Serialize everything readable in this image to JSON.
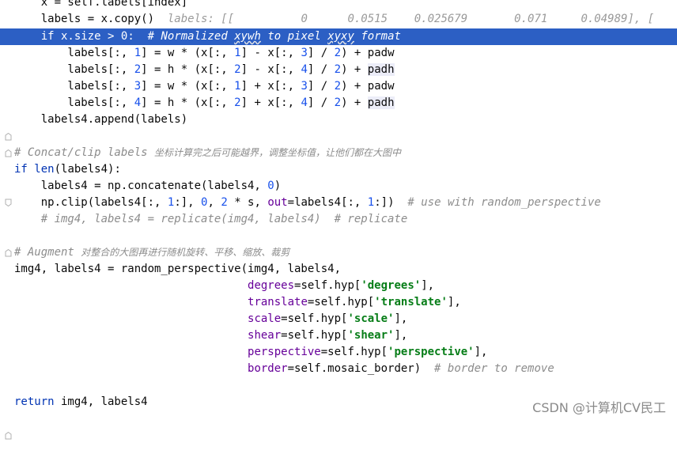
{
  "lines": [
    {
      "text": "    x = self.labels[index]"
    },
    {
      "prefix": "    labels = x.copy()",
      "hint": "  labels: [[          0      0.0515    0.025679       0.071     0.04989], ["
    },
    {
      "if_kw": "if",
      "mid1": " x.size > ",
      "num": "0",
      "mid2": ":  ",
      "cm_a": "# Normalized ",
      "cm_b": "xywh",
      "cm_c": " to pixel ",
      "cm_d": "xyxy",
      "cm_e": " format"
    },
    {
      "a": "        labels[:, ",
      "n1": "1",
      "b": "] = w * (x[:, ",
      "n2": "1",
      "c": "] - x[:, ",
      "n3": "3",
      "d": "] / ",
      "n4": "2",
      "e": ") + ",
      "pad": "padw"
    },
    {
      "a": "        labels[:, ",
      "n1": "2",
      "b": "] = h * (x[:, ",
      "n2": "2",
      "c": "] - x[:, ",
      "n3": "4",
      "d": "] / ",
      "n4": "2",
      "e": ") + ",
      "pad": "padh"
    },
    {
      "a": "        labels[:, ",
      "n1": "3",
      "b": "] = w * (x[:, ",
      "n2": "1",
      "c": "] + x[:, ",
      "n3": "3",
      "d": "] / ",
      "n4": "2",
      "e": ") + ",
      "pad": "padw"
    },
    {
      "a": "        labels[:, ",
      "n1": "4",
      "b": "] = h * (x[:, ",
      "n2": "2",
      "c": "] + x[:, ",
      "n3": "4",
      "d": "] / ",
      "n4": "2",
      "e": ") + ",
      "pad": "padh"
    },
    {
      "text": "    labels4.append(labels)"
    },
    {
      "cm_en": "# Concat/clip labels ",
      "cm_zh": "坐标计算完之后可能越界，调整坐标值，让他们都在大图中"
    },
    {
      "kw": "if",
      "sp": " ",
      "fn": "len",
      "rest": "(labels4):"
    },
    {
      "a": "    labels4 = np.concatenate(labels4, ",
      "n1": "0",
      "b": ")"
    },
    {
      "a": "    np.clip(labels4[:, ",
      "n1": "1",
      "b": ":], ",
      "n2": "0",
      "c": ", ",
      "n3": "2",
      "d": " * s, ",
      "named": "out",
      "e": "=labels4[:, ",
      "n4": "1",
      "f": ":])  ",
      "cm": "# use with random_perspective"
    },
    {
      "cm": "    # img4, labels4 = replicate(img4, labels4)  # replicate"
    },
    {
      "cm_en": "# Augment ",
      "cm_zh": "对整合的大图再进行随机旋转、平移、缩放、裁剪"
    },
    {
      "text": "img4, labels4 = random_perspective(img4, labels4,"
    },
    {
      "indent": "                                   ",
      "kwarg": "degrees",
      "a": "=self.hyp[",
      "str": "'degrees'",
      "b": "],"
    },
    {
      "indent": "                                   ",
      "kwarg": "translate",
      "a": "=self.hyp[",
      "str": "'translate'",
      "b": "],"
    },
    {
      "indent": "                                   ",
      "kwarg": "scale",
      "a": "=self.hyp[",
      "str": "'scale'",
      "b": "],"
    },
    {
      "indent": "                                   ",
      "kwarg": "shear",
      "a": "=self.hyp[",
      "str": "'shear'",
      "b": "],"
    },
    {
      "indent": "                                   ",
      "kwarg": "perspective",
      "a": "=self.hyp[",
      "str": "'perspective'",
      "b": "],"
    },
    {
      "indent": "                                   ",
      "kwarg": "border",
      "a": "=self.mosaic_border)  ",
      "cm": "# border to remove"
    },
    {
      "kw": "return",
      "rest": " img4, labels4"
    }
  ],
  "watermark": "CSDN @计算机CV民工",
  "colors": {
    "highlight": "#2c5fc4",
    "keyword": "#0033b3",
    "string": "#067d17",
    "number": "#1750eb",
    "named_arg": "#660099",
    "comment": "#8c8c8c"
  }
}
